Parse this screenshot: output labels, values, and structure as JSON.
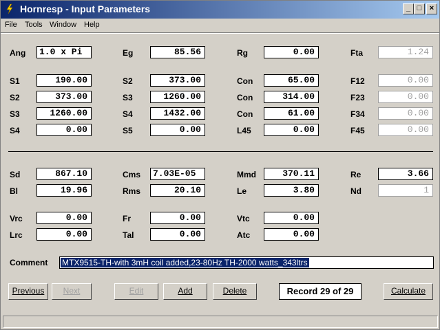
{
  "window": {
    "title": "Hornresp - Input Parameters"
  },
  "menu": [
    "File",
    "Tools",
    "Window",
    "Help"
  ],
  "fields": {
    "ang": {
      "label": "Ang",
      "value": "1.0 x Pi"
    },
    "eg": {
      "label": "Eg",
      "value": "85.56"
    },
    "rg": {
      "label": "Rg",
      "value": "0.00"
    },
    "fta": {
      "label": "Fta",
      "value": "1.24"
    },
    "s1": {
      "label": "S1",
      "value": "190.00"
    },
    "s2a": {
      "label": "S2",
      "value": "373.00"
    },
    "con1": {
      "label": "Con",
      "value": "65.00"
    },
    "f12": {
      "label": "F12",
      "value": "0.00"
    },
    "s2b": {
      "label": "S2",
      "value": "373.00"
    },
    "s3a": {
      "label": "S3",
      "value": "1260.00"
    },
    "con2": {
      "label": "Con",
      "value": "314.00"
    },
    "f23": {
      "label": "F23",
      "value": "0.00"
    },
    "s3b": {
      "label": "S3",
      "value": "1260.00"
    },
    "s4a": {
      "label": "S4",
      "value": "1432.00"
    },
    "con3": {
      "label": "Con",
      "value": "61.00"
    },
    "f34": {
      "label": "F34",
      "value": "0.00"
    },
    "s4b": {
      "label": "S4",
      "value": "0.00"
    },
    "s5": {
      "label": "S5",
      "value": "0.00"
    },
    "l45": {
      "label": "L45",
      "value": "0.00"
    },
    "f45": {
      "label": "F45",
      "value": "0.00"
    },
    "sd": {
      "label": "Sd",
      "value": "867.10"
    },
    "cms": {
      "label": "Cms",
      "value": "7.03E-05"
    },
    "mmd": {
      "label": "Mmd",
      "value": "370.11"
    },
    "re": {
      "label": "Re",
      "value": "3.66"
    },
    "bl": {
      "label": "Bl",
      "value": "19.96"
    },
    "rms": {
      "label": "Rms",
      "value": "20.10"
    },
    "le": {
      "label": "Le",
      "value": "3.80"
    },
    "nd": {
      "label": "Nd",
      "value": "1"
    },
    "vrc": {
      "label": "Vrc",
      "value": "0.00"
    },
    "fr": {
      "label": "Fr",
      "value": "0.00"
    },
    "vtc": {
      "label": "Vtc",
      "value": "0.00"
    },
    "lrc": {
      "label": "Lrc",
      "value": "0.00"
    },
    "tal": {
      "label": "Tal",
      "value": "0.00"
    },
    "atc": {
      "label": "Atc",
      "value": "0.00"
    }
  },
  "comment": {
    "label": "Comment",
    "value": "MTX9515-TH-with 3mH coil added,23-80Hz TH-2000 watts_343ltrs"
  },
  "buttons": {
    "previous": "Previous",
    "next": "Next",
    "edit": "Edit",
    "add": "Add",
    "delete": "Delete",
    "calculate": "Calculate"
  },
  "record": "Record 29 of 29",
  "colors": {
    "title_start": "#0a246a",
    "title_end": "#a6caf0",
    "selection": "#0a246a"
  }
}
